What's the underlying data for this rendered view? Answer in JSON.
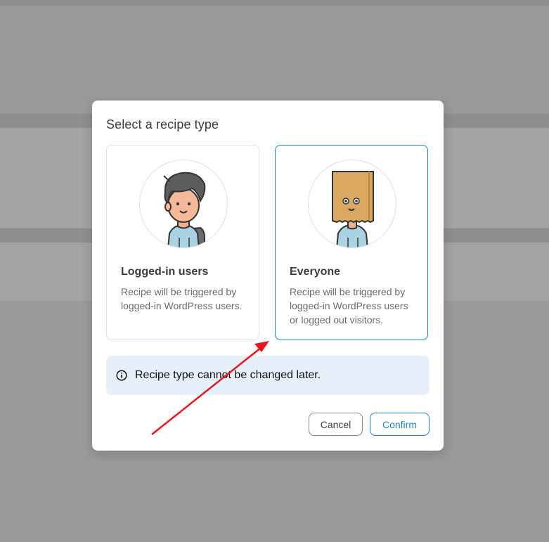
{
  "modal": {
    "title": "Select a recipe type",
    "cards": [
      {
        "title": "Logged-in users",
        "description": "Recipe will be triggered by logged-in WordPress users.",
        "illustration": "user-avatar-icon",
        "selected": false
      },
      {
        "title": "Everyone",
        "description": "Recipe will be triggered by logged-in WordPress users or logged out visitors.",
        "illustration": "paper-bag-head-icon",
        "selected": true
      }
    ],
    "notice": {
      "icon": "info-icon",
      "text": "Recipe type cannot be changed later."
    },
    "buttons": {
      "cancel": "Cancel",
      "confirm": "Confirm"
    }
  },
  "colors": {
    "accent": "#1b82c5",
    "notice_bg": "#e6f0fb",
    "overlay_bg": "#9a9a9a",
    "annotation_arrow": "#e8161a"
  }
}
